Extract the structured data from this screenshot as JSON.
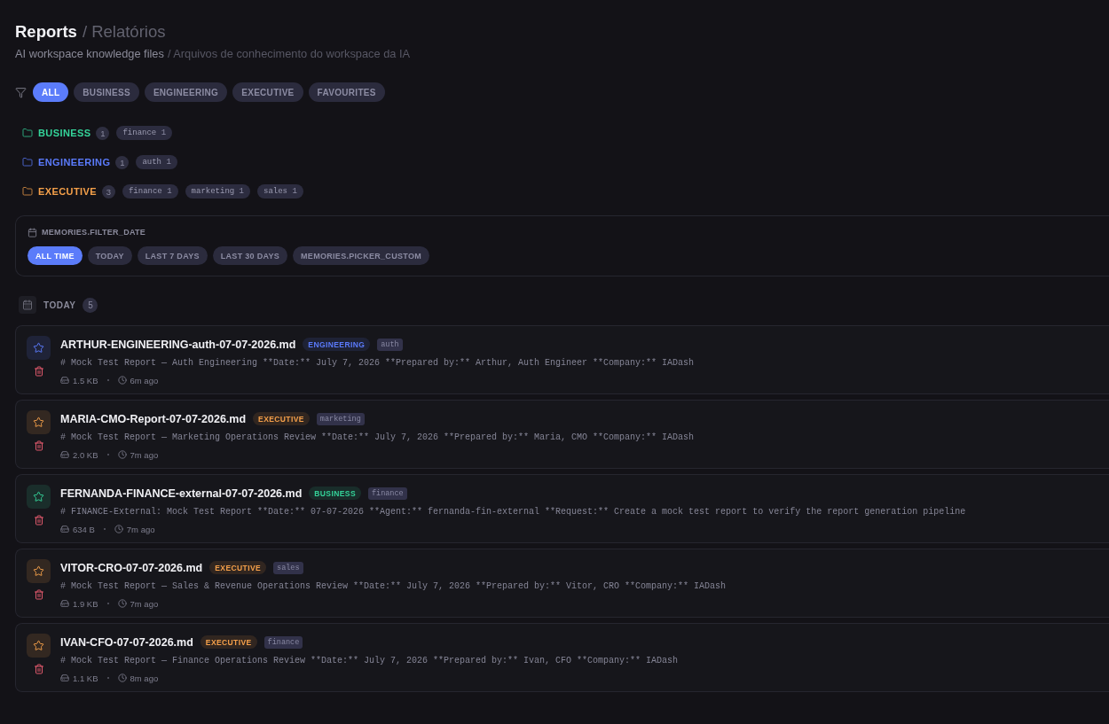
{
  "header": {
    "title": "Reports",
    "title_translation": "/ Relatórios",
    "subtitle": "AI workspace knowledge files",
    "subtitle_translation": "/ Arquivos de conhecimento do workspace da IA"
  },
  "filters": [
    {
      "label": "ALL",
      "selected": true
    },
    {
      "label": "BUSINESS",
      "selected": false
    },
    {
      "label": "ENGINEERING",
      "selected": false
    },
    {
      "label": "EXECUTIVE",
      "selected": false
    },
    {
      "label": "FAVOURITES",
      "selected": false
    }
  ],
  "groups": [
    {
      "name": "BUSINESS",
      "color": "#34d399",
      "count": "1",
      "tags": [
        {
          "name": "finance",
          "count": "1"
        }
      ]
    },
    {
      "name": "ENGINEERING",
      "color": "#5b7bfd",
      "count": "1",
      "tags": [
        {
          "name": "auth",
          "count": "1"
        }
      ]
    },
    {
      "name": "EXECUTIVE",
      "color": "#f5a04a",
      "count": "3",
      "tags": [
        {
          "name": "finance",
          "count": "1"
        },
        {
          "name": "marketing",
          "count": "1"
        },
        {
          "name": "sales",
          "count": "1"
        }
      ]
    }
  ],
  "date_filter": {
    "title": "MEMORIES.FILTER_DATE",
    "options": [
      {
        "label": "ALL TIME",
        "selected": true
      },
      {
        "label": "TODAY",
        "selected": false
      },
      {
        "label": "LAST 7 DAYS",
        "selected": false
      },
      {
        "label": "LAST 30 DAYS",
        "selected": false
      },
      {
        "label": "MEMORIES.PICKER_CUSTOM",
        "selected": false
      }
    ]
  },
  "sections": [
    {
      "title": "TODAY",
      "count": "5",
      "reports": [
        {
          "filename": "ARTHUR-ENGINEERING-auth-07-07-2026.md",
          "favourite": false,
          "category": {
            "label": "ENGINEERING",
            "color": "#5b7bfd"
          },
          "tags": [
            "auth"
          ],
          "snippet": "# Mock Test Report — Auth Engineering **Date:** July 7, 2026 **Prepared by:** Arthur, Auth Engineer **Company:** IADash",
          "size": "1.5 KB",
          "age": "6m ago"
        },
        {
          "filename": "MARIA-CMO-Report-07-07-2026.md",
          "favourite": false,
          "category": {
            "label": "EXECUTIVE",
            "color": "#f5a04a"
          },
          "tags": [
            "marketing"
          ],
          "snippet": "# Mock Test Report — Marketing Operations Review **Date:** July 7, 2026 **Prepared by:** Maria, CMO **Company:** IADash",
          "size": "2.0 KB",
          "age": "7m ago"
        },
        {
          "filename": "FERNANDA-FINANCE-external-07-07-2026.md",
          "favourite": false,
          "category": {
            "label": "BUSINESS",
            "color": "#34d399"
          },
          "tags": [
            "finance"
          ],
          "snippet": "# FINANCE-External: Mock Test Report **Date:** 07-07-2026 **Agent:** fernanda-fin-external **Request:** Create a mock test report to verify the report generation pipeline",
          "size": "634 B",
          "age": "7m ago"
        },
        {
          "filename": "VITOR-CRO-07-07-2026.md",
          "favourite": false,
          "category": {
            "label": "EXECUTIVE",
            "color": "#f5a04a"
          },
          "tags": [
            "sales"
          ],
          "snippet": "# Mock Test Report — Sales & Revenue Operations Review **Date:** July 7, 2026 **Prepared by:** Vitor, CRO **Company:** IADash",
          "size": "1.9 KB",
          "age": "7m ago"
        },
        {
          "filename": "IVAN-CFO-07-07-2026.md",
          "favourite": false,
          "category": {
            "label": "EXECUTIVE",
            "color": "#f5a04a"
          },
          "tags": [
            "finance"
          ],
          "snippet": "# Mock Test Report — Finance Operations Review **Date:** July 7, 2026 **Prepared by:** Ivan, CFO **Company:** IADash",
          "size": "1.1 KB",
          "age": "8m ago"
        }
      ]
    }
  ]
}
